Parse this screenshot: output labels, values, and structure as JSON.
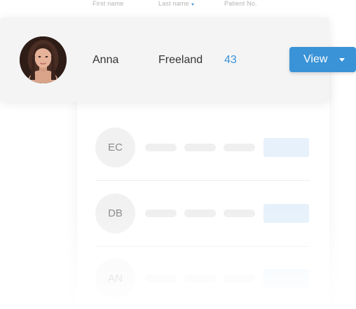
{
  "columns": {
    "first_name": "First name",
    "last_name": "Last name",
    "patient_no": "Patient No.",
    "sort_icon": "caret-down-icon"
  },
  "selected_patient": {
    "first_name": "Anna",
    "last_name": "Freeland",
    "patient_no": "43",
    "action_label": "View",
    "action_icon": "caret-down-icon"
  },
  "placeholder_rows": [
    {
      "initials": "EC"
    },
    {
      "initials": "DB"
    },
    {
      "initials": "AN"
    }
  ],
  "colors": {
    "accent": "#3a93d7",
    "row_highlight": "#f4f4f4",
    "skeleton": "#efefef",
    "skeleton_button": "#e6f1fb"
  }
}
